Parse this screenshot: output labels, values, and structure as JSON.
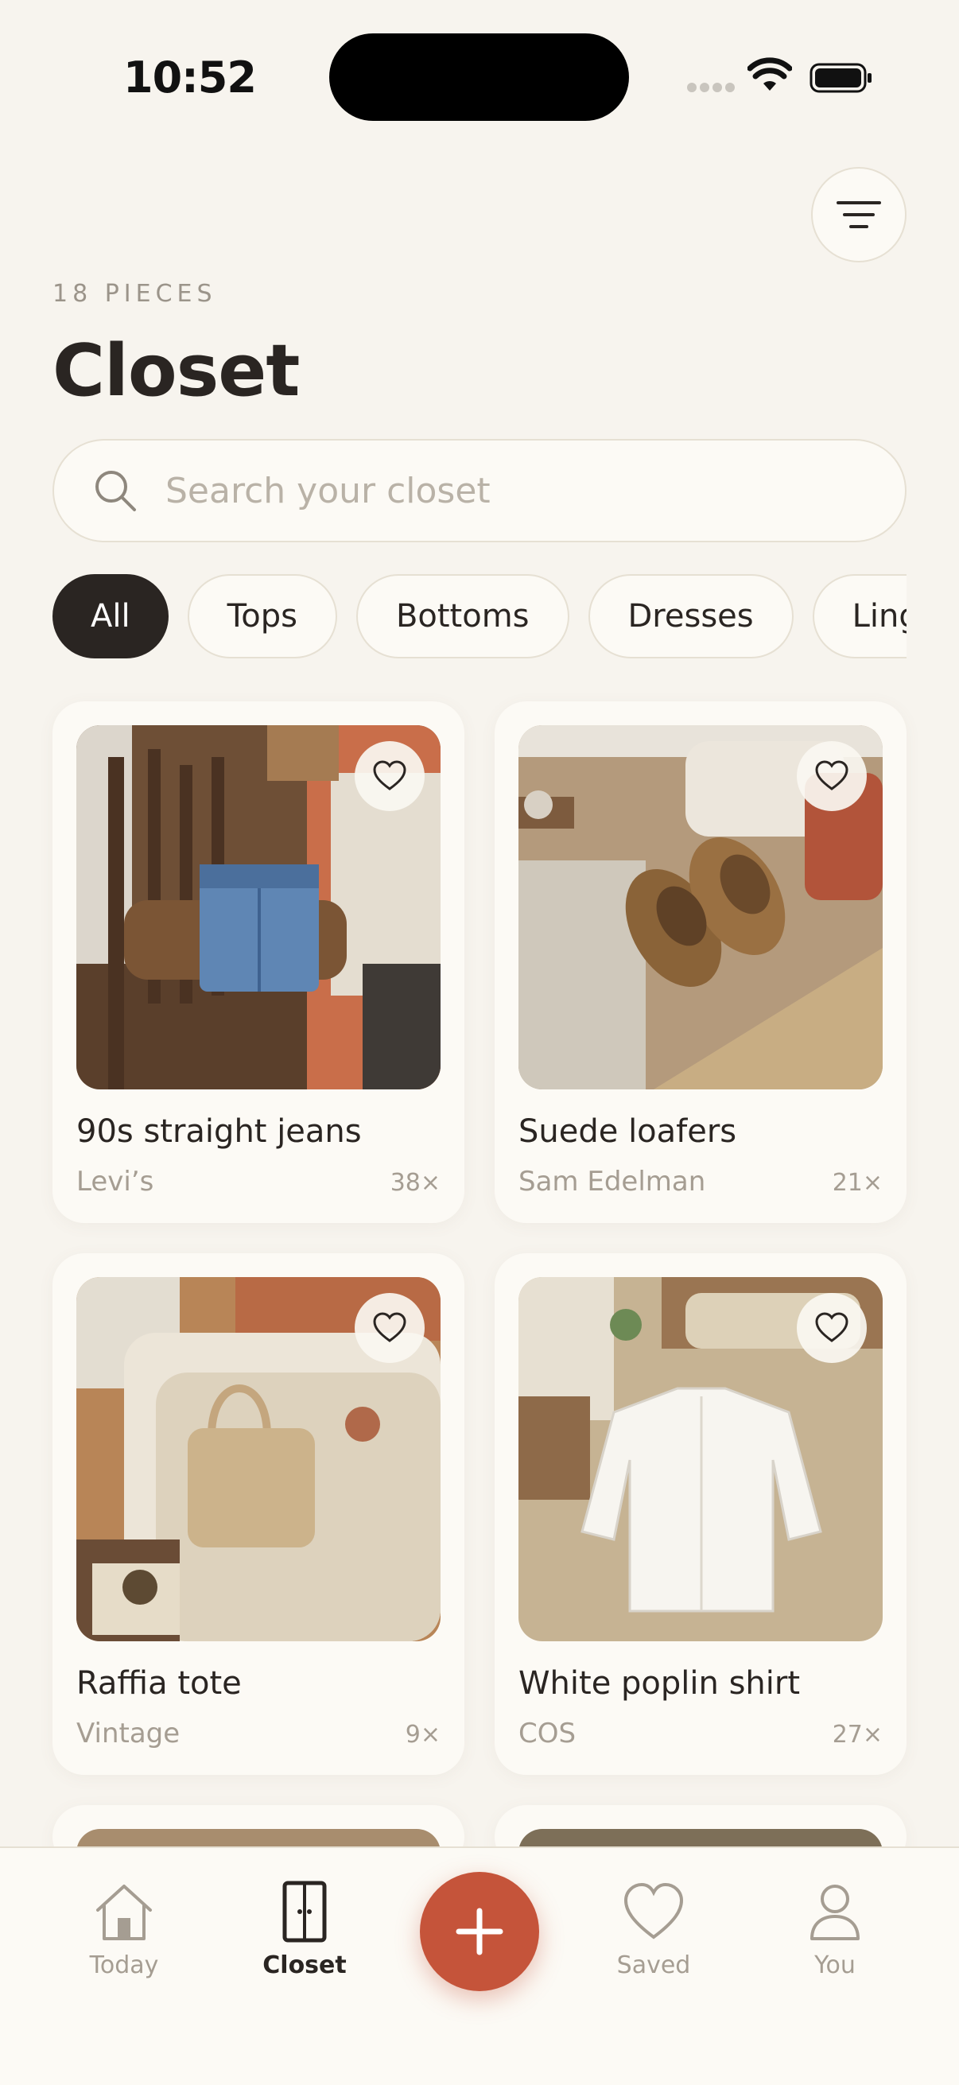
{
  "status_bar": {
    "time": "10:52"
  },
  "header": {
    "count_label": "18 PIECES",
    "title": "Closet"
  },
  "search": {
    "placeholder": "Search your closet"
  },
  "categories": [
    {
      "label": "All",
      "selected": true
    },
    {
      "label": "Tops",
      "selected": false
    },
    {
      "label": "Bottoms",
      "selected": false
    },
    {
      "label": "Dresses",
      "selected": false
    },
    {
      "label": "Linge",
      "selected": false
    }
  ],
  "items": [
    {
      "name": "90s straight jeans",
      "brand": "Levi’s",
      "wears": "38×"
    },
    {
      "name": "Suede loafers",
      "brand": "Sam Edelman",
      "wears": "21×"
    },
    {
      "name": "Raffia tote",
      "brand": "Vintage",
      "wears": "9×"
    },
    {
      "name": "White poplin shirt",
      "brand": "COS",
      "wears": "27×"
    }
  ],
  "tabbar": {
    "tabs": [
      {
        "label": "Today",
        "icon": "house-icon",
        "active": false
      },
      {
        "label": "Closet",
        "icon": "wardrobe-icon",
        "active": true
      },
      {
        "label": "Saved",
        "icon": "heart-icon",
        "active": false
      },
      {
        "label": "You",
        "icon": "person-icon",
        "active": false
      }
    ],
    "fab_icon": "plus-icon"
  },
  "colors": {
    "background": "#f7f4ee",
    "card": "#fcfaf5",
    "accent": "#c5543a",
    "chip_active": "#2a2522",
    "muted_text": "#a59d92"
  }
}
